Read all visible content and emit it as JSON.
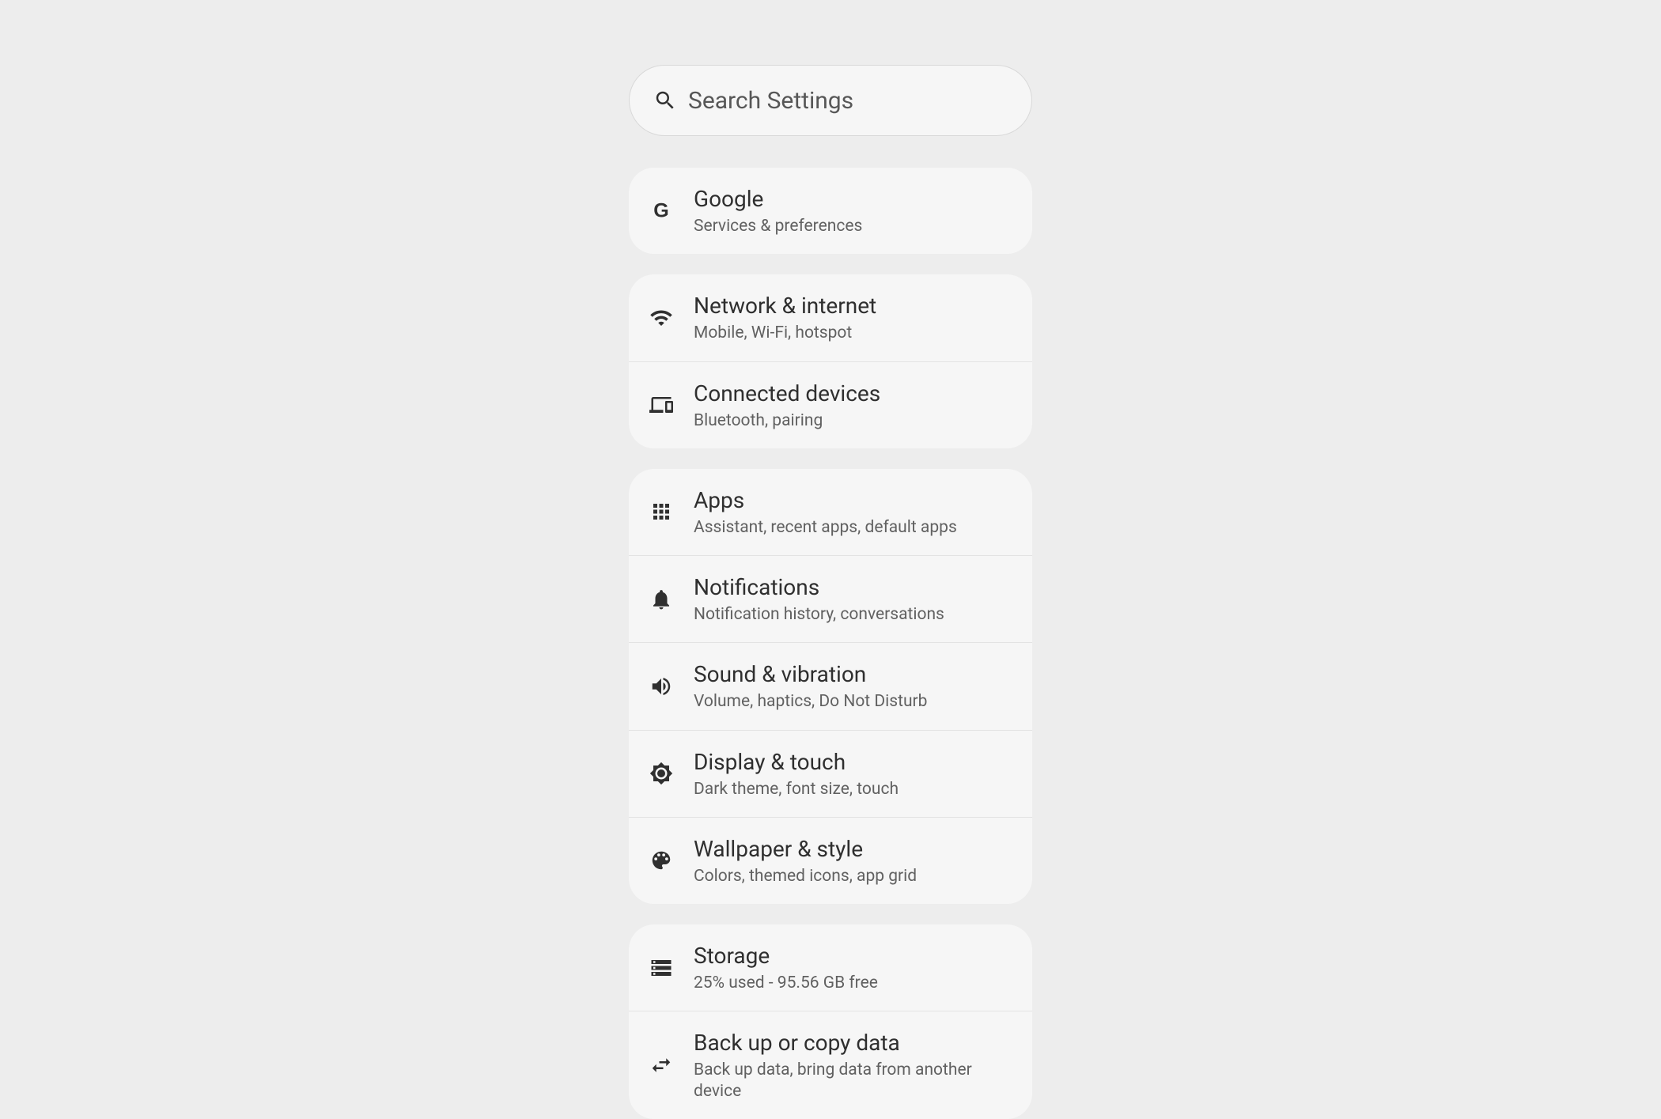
{
  "search": {
    "placeholder": "Search Settings"
  },
  "groups": [
    {
      "items": [
        {
          "key": "google",
          "icon": "google-icon",
          "title": "Google",
          "subtitle": "Services & preferences"
        }
      ]
    },
    {
      "items": [
        {
          "key": "network",
          "icon": "wifi-icon",
          "title": "Network & internet",
          "subtitle": "Mobile, Wi-Fi, hotspot"
        },
        {
          "key": "connected",
          "icon": "devices-icon",
          "title": "Connected devices",
          "subtitle": "Bluetooth, pairing"
        }
      ]
    },
    {
      "items": [
        {
          "key": "apps",
          "icon": "apps-icon",
          "title": "Apps",
          "subtitle": "Assistant, recent apps, default apps"
        },
        {
          "key": "notifications",
          "icon": "bell-icon",
          "title": "Notifications",
          "subtitle": "Notification history, conversations"
        },
        {
          "key": "sound",
          "icon": "volume-icon",
          "title": "Sound & vibration",
          "subtitle": "Volume, haptics, Do Not Disturb"
        },
        {
          "key": "display",
          "icon": "brightness-icon",
          "title": "Display & touch",
          "subtitle": "Dark theme, font size, touch"
        },
        {
          "key": "wallpaper",
          "icon": "palette-icon",
          "title": "Wallpaper & style",
          "subtitle": "Colors, themed icons, app grid"
        }
      ]
    },
    {
      "items": [
        {
          "key": "storage",
          "icon": "storage-icon",
          "title": "Storage",
          "subtitle": "25% used - 95.56 GB free"
        },
        {
          "key": "backup",
          "icon": "swap-icon",
          "title": "Back up or copy data",
          "subtitle": "Back up data, bring data from another device"
        }
      ]
    }
  ]
}
